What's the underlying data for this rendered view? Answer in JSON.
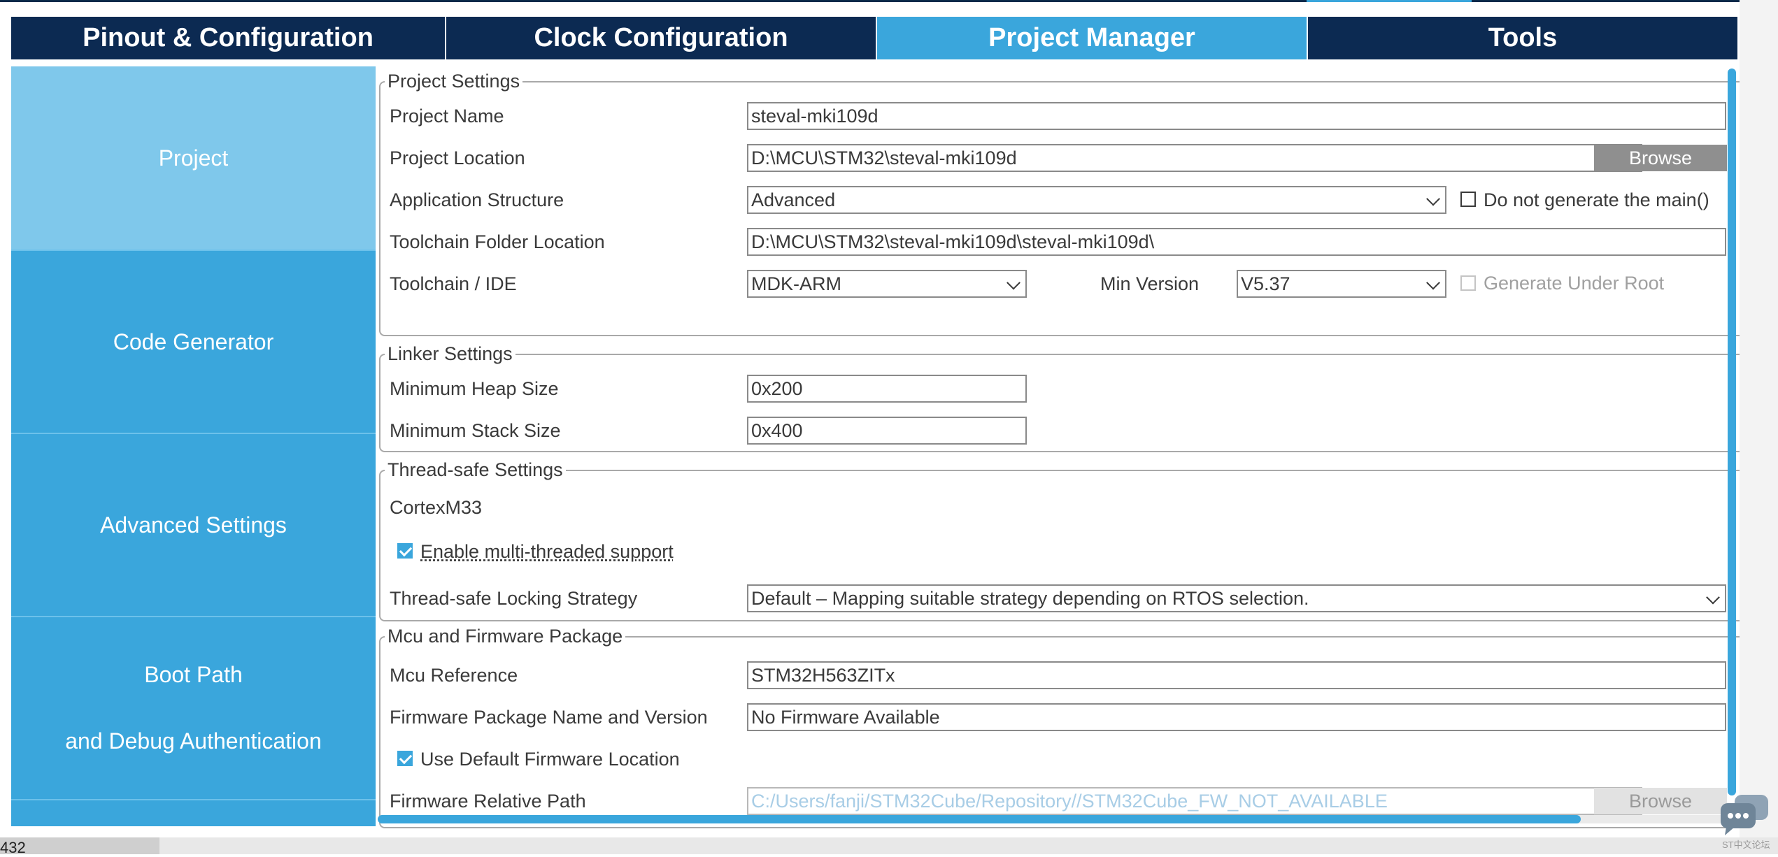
{
  "tabs": [
    {
      "label": "Pinout & Configuration",
      "active": false
    },
    {
      "label": "Clock Configuration",
      "active": false
    },
    {
      "label": "Project Manager",
      "active": true
    },
    {
      "label": "Tools",
      "active": false
    }
  ],
  "sidebar": {
    "items": [
      {
        "label": "Project",
        "active": true
      },
      {
        "label": "Code Generator",
        "active": false
      },
      {
        "label": "Advanced Settings",
        "active": false
      },
      {
        "label": "Boot Path",
        "label2": "and Debug Authentication",
        "active": false
      }
    ]
  },
  "project_settings": {
    "title": "Project Settings",
    "project_name_label": "Project Name",
    "project_name": "steval-mki109d",
    "project_location_label": "Project Location",
    "project_location": "D:\\MCU\\STM32\\steval-mki109d",
    "browse_label": "Browse",
    "app_structure_label": "Application Structure",
    "app_structure": "Advanced",
    "do_not_generate_main_label": "Do not generate the main()",
    "do_not_generate_main_checked": false,
    "toolchain_folder_label": "Toolchain Folder Location",
    "toolchain_folder": "D:\\MCU\\STM32\\steval-mki109d\\steval-mki109d\\",
    "toolchain_ide_label": "Toolchain / IDE",
    "toolchain_ide": "MDK-ARM",
    "min_version_label": "Min Version",
    "min_version": "V5.37",
    "generate_under_root_label": "Generate Under Root",
    "generate_under_root_checked": false
  },
  "linker_settings": {
    "title": "Linker Settings",
    "min_heap_label": "Minimum Heap Size",
    "min_heap": "0x200",
    "min_stack_label": "Minimum Stack Size",
    "min_stack": "0x400"
  },
  "thread_safe": {
    "title": "Thread-safe Settings",
    "core": "CortexM33",
    "enable_multithread_label": "Enable multi-threaded support",
    "enable_multithread_checked": true,
    "locking_strategy_label": "Thread-safe Locking Strategy",
    "locking_strategy": "Default – Mapping suitable strategy depending on RTOS selection."
  },
  "mcu_firmware": {
    "title": "Mcu and Firmware Package",
    "mcu_reference_label": "Mcu Reference",
    "mcu_reference": "STM32H563ZITx",
    "firmware_package_label": "Firmware Package Name and Version",
    "firmware_package": "No Firmware Available",
    "use_default_location_label": "Use Default Firmware Location",
    "use_default_location_checked": true,
    "firmware_path_label": "Firmware Relative Path",
    "firmware_path": "C:/Users/fanji/STM32Cube/Repository//STM32Cube_FW_NOT_AVAILABLE",
    "browse_label": "Browse"
  },
  "bottom_text": "432",
  "colors": {
    "tab_bar": "#0c2a52",
    "accent": "#3aa6dc",
    "sidebar_active": "#7fc8eb"
  }
}
